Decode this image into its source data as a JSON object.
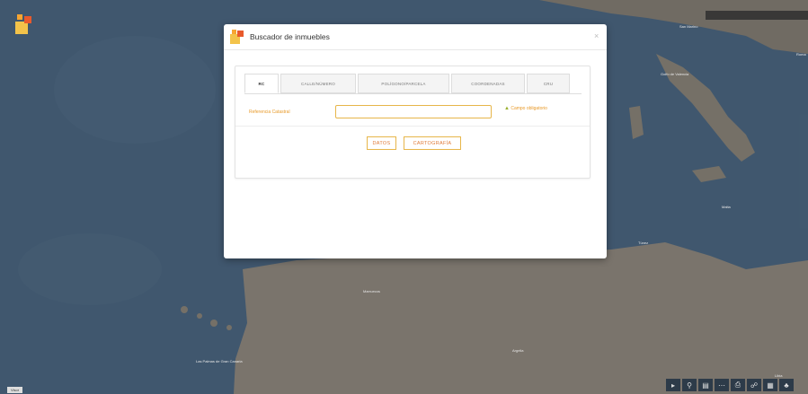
{
  "map": {
    "labels": [
      "Las Palmas de Gran Canaria",
      "Marruecos",
      "Argelia",
      "Túnez",
      "Malta",
      "Golfo de Valencia",
      "San Marino",
      "Roma",
      "Libia"
    ],
    "scale_label": "Visor"
  },
  "modal": {
    "title": "Buscador de inmuebles",
    "close": "×",
    "tabs": [
      "RC",
      "CALLE/NÚMERO",
      "POLÍGONO/PARCELA",
      "COORDENADAS",
      "CRU"
    ],
    "form": {
      "label": "Referencia Catastral",
      "input_value": "",
      "required_icon": "▲",
      "required_text": "Campo obligatorio"
    },
    "buttons": {
      "datos": "DATOS",
      "cartografia": "CARTOGRAFÍA"
    }
  },
  "toolbar": {
    "icons": [
      "arrow-icon",
      "search-icon",
      "layers-icon",
      "ruler-icon",
      "print-icon",
      "share-icon",
      "grid-icon",
      "tree-icon"
    ],
    "glyphs": [
      "▸",
      "⚲",
      "▤",
      "⋯",
      "⎙",
      "☍",
      "▦",
      "♣"
    ]
  },
  "colors": {
    "accent_orange": "#e07b39",
    "input_border": "#e7b64a",
    "warning_green": "#9bb130"
  }
}
